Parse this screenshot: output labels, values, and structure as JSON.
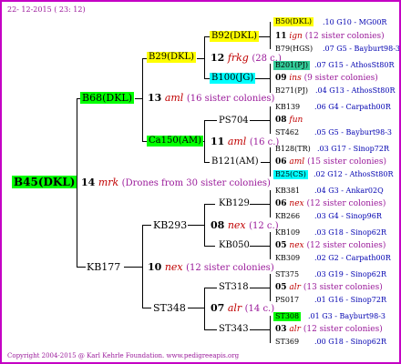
{
  "header": {
    "date": "22- 12-2015 ( 23: 12)"
  },
  "footer": {
    "copyright": "Copyright 2004-2015 @ Karl Kehrle Foundation.",
    "url": "www.pedigreeapis.org"
  },
  "colors": {
    "frame": "#c400c4",
    "green": "#00ff00",
    "yellow": "#ffff00",
    "cyan": "#00ffff",
    "teal": "#33cc99"
  },
  "root": {
    "id": "B45(DKL)",
    "num": "14",
    "code": "mrk",
    "note": "(Drones from 30 sister colonies)"
  },
  "gen1": {
    "top": {
      "id": "B68(DKL)",
      "num": "13",
      "code": "aml",
      "note": "(16 sister colonies)"
    },
    "bottom": {
      "id": "KB177",
      "num": "10",
      "code": "nex",
      "note": "(12 sister colonies)"
    }
  },
  "gen2": {
    "b29": {
      "id": "B29(DKL)",
      "num": "12",
      "code": "frkg",
      "note": "(28 c.)"
    },
    "ca150": {
      "id": "Ca150(AM)",
      "num": "11",
      "code": "aml",
      "note": "(16 c.)"
    },
    "kb293": {
      "id": "KB293",
      "num": "08",
      "code": "nex",
      "note": "(12 c.)"
    },
    "st348": {
      "id": "ST348",
      "num": "07",
      "code": "alr",
      "note": "(14 c.)"
    }
  },
  "gen3": {
    "b92": {
      "id": "B92(DKL)",
      "num": "11",
      "code": "ign",
      "note": "(12 sister colonies)"
    },
    "b100": {
      "id": "B100(JG)",
      "num": "09",
      "code": "ins",
      "note": "(9 sister colonies)"
    },
    "ps704": {
      "id": "PS704",
      "num": "08",
      "code": "fun"
    },
    "b121": {
      "id": "B121(AM)",
      "num": "06",
      "code": "aml",
      "note": "(15 sister colonies)"
    },
    "kb129": {
      "id": "KB129",
      "num": "06",
      "code": "nex",
      "note": "(12 sister colonies)"
    },
    "kb050": {
      "id": "KB050",
      "num": "05",
      "code": "nex",
      "note": "(12 sister colonies)"
    },
    "st318": {
      "id": "ST318",
      "num": "05",
      "code": "alr",
      "note": "(13 sister colonies)"
    },
    "st343": {
      "id": "ST343",
      "num": "03",
      "code": "alr",
      "note": "(12 sister colonies)"
    }
  },
  "gen4": [
    {
      "id": "B50(DKL)",
      "year": ".10",
      "ref": "G10 - MG00R"
    },
    {
      "id": "B79(HGS)",
      "year": ".07",
      "ref": "G5 - Bayburt98-3"
    },
    {
      "id": "B201(PJ)",
      "year": ".07",
      "ref": "G15 - AthosSt80R"
    },
    {
      "id": "B271(PJ)",
      "year": ".04",
      "ref": "G13 - AthosSt80R"
    },
    {
      "id": "KB139",
      "year": ".06",
      "ref": "G4 - Carpath00R"
    },
    {
      "id": "ST462",
      "year": ".05",
      "ref": "G5 - Bayburt98-3"
    },
    {
      "id": "B128(TR)",
      "year": ".03",
      "ref": "G17 - Sinop72R"
    },
    {
      "id": "B25(CS)",
      "year": ".02",
      "ref": "G12 - AthosSt80R"
    },
    {
      "id": "KB381",
      "year": ".04",
      "ref": "G3 - Ankar02Q"
    },
    {
      "id": "KB266",
      "year": ".03",
      "ref": "G4 - Sinop96R"
    },
    {
      "id": "KB109",
      "year": ".03",
      "ref": "G18 - Sinop62R"
    },
    {
      "id": "KB309",
      "year": ".02",
      "ref": "G2 - Carpath00R"
    },
    {
      "id": "ST375",
      "year": ".03",
      "ref": "G19 - Sinop62R"
    },
    {
      "id": "PS017",
      "year": ".01",
      "ref": "G16 - Sinop72R"
    },
    {
      "id": "ST308",
      "year": ".01",
      "ref": "G3 - Bayburt98-3"
    },
    {
      "id": "ST369",
      "year": ".00",
      "ref": "G18 - Sinop62R"
    }
  ]
}
